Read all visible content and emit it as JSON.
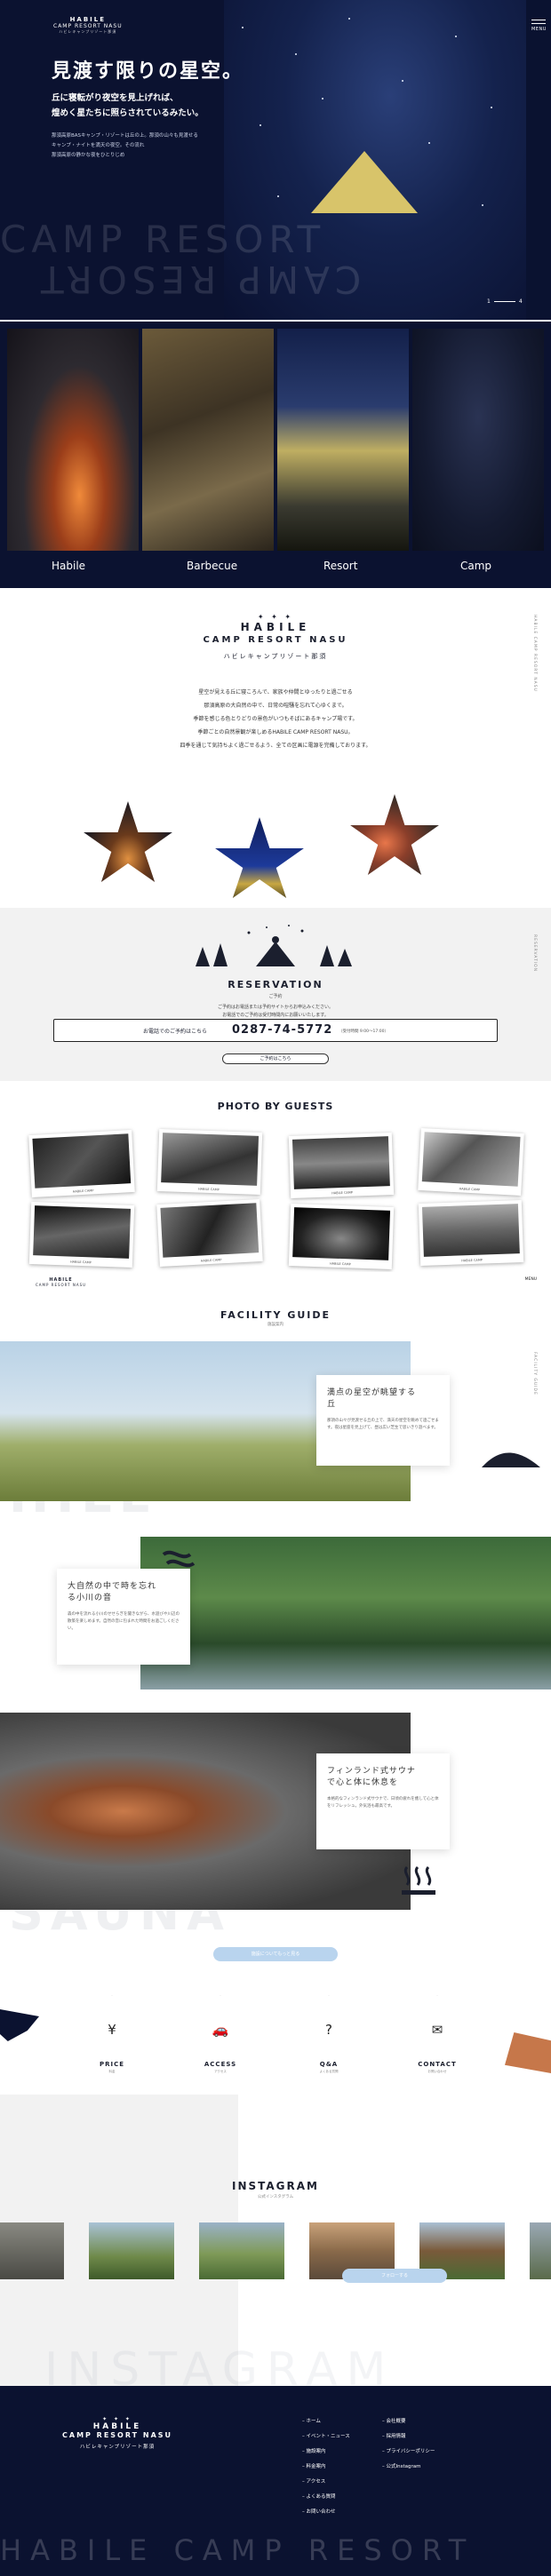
{
  "header": {
    "logo_line1": "HABILE",
    "logo_line2": "CAMP RESORT NASU",
    "logo_line3": "ハビレキャンプリゾート那須",
    "menu_label": "MENU"
  },
  "hero": {
    "title": "見渡す限りの星空。",
    "subtitle_line1": "丘に寝転がり夜空を見上げれば、",
    "subtitle_line2": "煌めく星たちに照らされているみたい。",
    "desc_line1": "那須高原BASキャンプ・リゾートは丘の上。那須の山々も見渡せる",
    "desc_line2": "キャンプ・ナイトを満天の夜空。その流れ",
    "desc_line3": "那須高原の静かな夜をひとりじめ",
    "bg_text": "CAMP RESORT",
    "pager_current": "1",
    "pager_total": "4"
  },
  "categories": [
    {
      "label": "Habile"
    },
    {
      "label": "Barbecue"
    },
    {
      "label": "Resort"
    },
    {
      "label": "Camp"
    }
  ],
  "about": {
    "dots": "✦ ✦ ✦",
    "line1": "HABILE",
    "line2": "CAMP RESORT NASU",
    "line3": "ハビレキャンプリゾート那須",
    "vertical": "HABILE CAMP RESORT NASU",
    "text": [
      "星空が見える丘に寝ころんで、家族や仲間とゆったりと過ごせる",
      "那須高原の大自然の中で、日常の喧騒を忘れて心ゆくまで。",
      "季節を感じる色とりどりの景色がいつもそばにあるキャンプ場です。",
      "季節ごとの自然景観が楽しめるHABILE CAMP RESORT NASU。",
      "四季を通じて気持ちよく過ごせるよう、全ての区画に電源を完備しております。"
    ]
  },
  "reservation": {
    "title": "RESERVATION",
    "sub": "ご予約",
    "desc_line1": "ご予約はお電話または予約サイトからお申込みください。",
    "desc_line2": "お電話でのご予約は受付時間内にお願いいたします。",
    "tel_label": "お電話でのご予約はこちら",
    "tel_number": "0287-74-5772",
    "tel_hours": "（受付時間 9:00〜17:00）",
    "button": "ご予約はこちら",
    "vertical": "RESERVATION"
  },
  "guests": {
    "title": "PHOTO BY GUESTS",
    "captions": [
      "HABILE CAMP",
      "HABILE CAMP",
      "HABILE CAMP",
      "HABILE CAMP",
      "HABILE CAMP",
      "HABILE CAMP",
      "HABILE CAMP",
      "HABILE CAMP"
    ]
  },
  "facility": {
    "title": "FACILITY GUIDE",
    "sub": "施設案内",
    "menu": "MENU",
    "vertical": "FACILITY GUIDE",
    "items": [
      {
        "title_line1": "満点の星空が眺望する",
        "title_line2": "丘",
        "desc": "那須の山々が見渡せる丘の上で、満天の星空を眺めて過ごせます。夜は星座を見上げて、昼は広い芝生で思いきり遊べます。",
        "bg": "HILL"
      },
      {
        "title_line1": "大自然の中で時を忘れ",
        "title_line2": "る小川の音",
        "desc": "森の中を流れる小川のせせらぎを聞きながら、水遊びや川辺の散策を楽しめます。自然の音に包まれた時間をお過ごしください。",
        "bg": "RIVER"
      },
      {
        "title_line1": "フィンランド式サウナ",
        "title_line2": "で心と体に休息を",
        "desc": "本格的なフィンランド式サウナで、日頃の疲れを癒して心と体をリフレッシュ。外気浴も最高です。",
        "bg": "SAUNA"
      }
    ],
    "button": "施設についてもっと見る"
  },
  "quick_links": [
    {
      "label": "PRICE",
      "sub": "料金",
      "icon": "yen-icon"
    },
    {
      "label": "ACCESS",
      "sub": "アクセス",
      "icon": "car-icon"
    },
    {
      "label": "Q&A",
      "sub": "よくある質問",
      "icon": "question-icon"
    },
    {
      "label": "CONTACT",
      "sub": "お問い合わせ",
      "icon": "mail-icon"
    }
  ],
  "instagram": {
    "title": "INSTAGRAM",
    "sub": "公式インスタグラム",
    "button": "フォローする",
    "bg_text": "INSTAGRAM"
  },
  "footer": {
    "dots": "✦ ✦ ✦",
    "logo_line1": "HABILE",
    "logo_line2": "CAMP RESORT NASU",
    "logo_line3": "ハビレキャンプリゾート那須",
    "col1": [
      "ホーム",
      "イベント・ニュース",
      "施設案内",
      "料金案内",
      "アクセス",
      "よくある質問",
      "お問い合わせ"
    ],
    "col2": [
      "会社概要",
      "採用情報",
      "プライバシーポリシー",
      "公式Instagram"
    ],
    "bg_text": "HABILE CAMP RESORT"
  },
  "colors": {
    "navy": "#0b1230",
    "accent_blue": "#b9d4ee",
    "light_gray": "#f2f2f2"
  }
}
